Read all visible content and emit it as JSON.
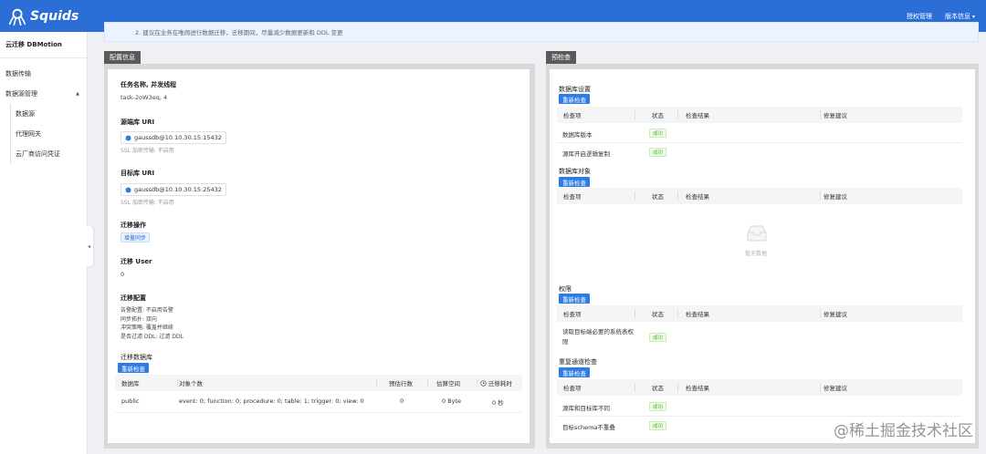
{
  "header": {
    "brand": "Squids",
    "menu": [
      {
        "label": "授权管理"
      },
      {
        "label": "版本信息",
        "caret": "▾"
      }
    ]
  },
  "sidebar": {
    "title": "云迁移 DBMotion",
    "items": [
      {
        "label": "数据传输"
      },
      {
        "label": "数据源管理",
        "arrow": "▲"
      }
    ],
    "sub_items": [
      {
        "label": "数据源"
      },
      {
        "label": "代理网关"
      },
      {
        "label": "云厂商访问凭证"
      }
    ],
    "collapse_glyph": "◂"
  },
  "notice": {
    "text": "2. 建议在业务在唯闹进行数据迁移，迁移期间，尽量减少数据更新和 DDL 变更"
  },
  "config_panel": {
    "tab": "配置信息",
    "task_label": "任务名称, 并发线程",
    "task_value": "task-2oW3eq, 4",
    "source_label": "源端库 URI",
    "source_uri": "gaussdb@10.10.30.15:15432",
    "source_ssl": "SSL 加密传输: 不启用",
    "target_label": "目标库 URI",
    "target_uri": "gaussdb@10.10.30.15:25432",
    "target_ssl": "SSL 加密传输: 不启用",
    "op_label": "迁移操作",
    "op_tag": "增量同步",
    "user_label": "迁移 User",
    "user_value": "0",
    "settings_label": "迁移配置",
    "settings_lines": [
      "告警配置: 不启用告警",
      "同步拓扑: 双向",
      "冲突策略: 覆盖并继续",
      "是否过滤 DDL: 过滤 DDL"
    ],
    "db_label": "迁移数据库",
    "recheck": "重新检查",
    "db_table": {
      "headers": [
        "数据库",
        "对象个数",
        "预估行数",
        "估算空间",
        "迁移耗时"
      ],
      "time_icon": "clock-icon",
      "rows": [
        {
          "db": "public",
          "objects": "event: 0; function: 0; procedure: 0; table: 1; trigger: 0; view: 0",
          "rows": "0",
          "space": "0 Byte",
          "time": "0 秒"
        }
      ]
    }
  },
  "precheck_panel": {
    "tab": "预检查",
    "recheck": "重新检查",
    "headers": [
      "检查项",
      "状态",
      "检查结果",
      "修复建议"
    ],
    "ok_label": "成功",
    "sections": [
      {
        "title": "数据库设置",
        "rows": [
          {
            "item": "数据库版本",
            "status": "成功"
          },
          {
            "item": "源库开启逻辑复制",
            "status": "成功"
          }
        ]
      },
      {
        "title": "数据库对象",
        "rows": [],
        "empty_text": "暂无数据"
      },
      {
        "title": "权限",
        "rows": [
          {
            "item": "读取目标端必要的系统表权限",
            "status": "成功"
          }
        ]
      },
      {
        "title": "重复通道检查",
        "rows": [
          {
            "item": "源库和目标库不同",
            "status": "成功"
          },
          {
            "item": "目标schema不重叠",
            "status": "成功"
          }
        ]
      }
    ]
  },
  "watermark": "@稀土掘金技术社区",
  "colors": {
    "header_bg": "#2b6fd6",
    "button_blue": "#2f7be6",
    "success_green": "#52b52c"
  }
}
